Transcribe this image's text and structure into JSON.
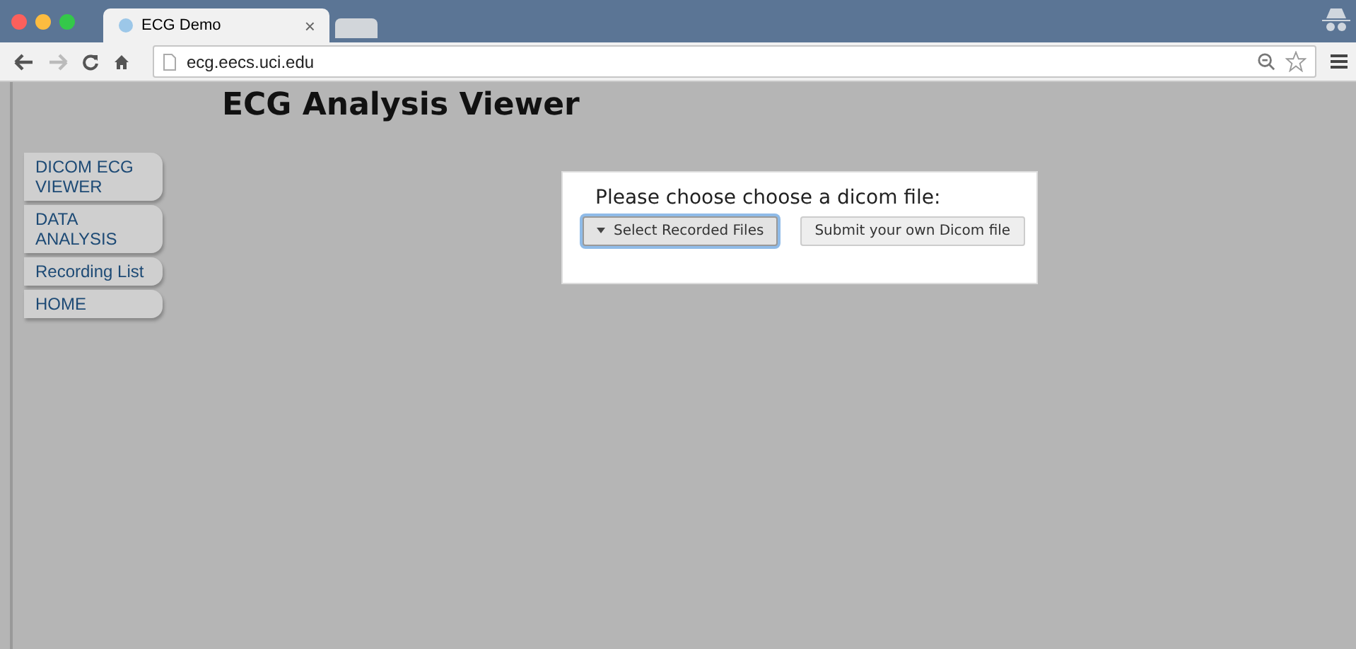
{
  "browser": {
    "tab_title": "ECG Demo",
    "tab_close": "×",
    "url": "ecg.eecs.uci.edu"
  },
  "page": {
    "title": "ECG Analysis Viewer"
  },
  "sidebar": {
    "items": [
      {
        "label": "DICOM ECG VIEWER"
      },
      {
        "label": "DATA ANALYSIS"
      },
      {
        "label": "Recording List"
      },
      {
        "label": "HOME"
      }
    ]
  },
  "dialog": {
    "prompt": "Please choose choose a dicom file:",
    "buttons": [
      {
        "kind": "dropdown",
        "label": "Select Recorded Files",
        "focused": true
      },
      {
        "kind": "plain",
        "label": "Submit your own Dicom file",
        "focused": false
      }
    ]
  }
}
